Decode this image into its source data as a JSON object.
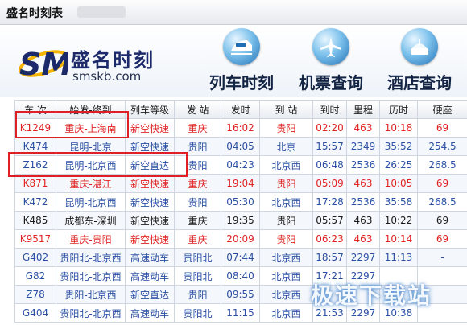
{
  "window": {
    "title": "盛名时刻表"
  },
  "brand": {
    "name": "盛名时刻",
    "domain": "smskb.com",
    "mark": "SM"
  },
  "nav": [
    {
      "label": "列车时刻",
      "icon": "train-icon"
    },
    {
      "label": "机票查询",
      "icon": "airplane-icon"
    },
    {
      "label": "酒店查询",
      "icon": "hotel-icon"
    }
  ],
  "table": {
    "columns": [
      "车 次",
      "始发-终到",
      "列车等级",
      "发 站",
      "发时",
      "到 站",
      "到时",
      "里程",
      "历时",
      "硬座"
    ],
    "rows": [
      {
        "style": "red",
        "cells": [
          "K1249",
          "重庆-上海南",
          "新空快速",
          "重庆",
          "16:02",
          "贵阳",
          "02:20",
          "463",
          "10:18",
          "69"
        ]
      },
      {
        "style": "blue",
        "cells": [
          "K474",
          "昆明-北京",
          "新空快速",
          "贵阳",
          "04:05",
          "北京",
          "15:57",
          "2349",
          "35:52",
          "254.5"
        ]
      },
      {
        "style": "blue",
        "cells": [
          "Z162",
          "昆明-北京西",
          "新空直达",
          "贵阳",
          "04:23",
          "北京西",
          "06:48",
          "2536",
          "26:25",
          "268.5"
        ]
      },
      {
        "style": "red",
        "cells": [
          "K871",
          "重庆-湛江",
          "新空快速",
          "重庆",
          "19:04",
          "贵阳",
          "05:09",
          "463",
          "10:05",
          "69"
        ]
      },
      {
        "style": "blue",
        "cells": [
          "K472",
          "昆明-北京西",
          "新空快速",
          "贵阳",
          "05:30",
          "北京西",
          "17:28",
          "2536",
          "35:58",
          "268.5"
        ]
      },
      {
        "style": "black",
        "cells": [
          "K485",
          "成都东-深圳",
          "新空快速",
          "重庆",
          "19:35",
          "贵阳",
          "05:57",
          "463",
          "10:22",
          "69"
        ]
      },
      {
        "style": "red",
        "cells": [
          "K9517",
          "重庆-贵阳",
          "新空快速",
          "重庆",
          "20:09",
          "贵阳",
          "06:23",
          "463",
          "10:14",
          "69"
        ]
      },
      {
        "style": "blue",
        "cells": [
          "G402",
          "贵阳北-北京西",
          "高速动车",
          "贵阳北",
          "07:44",
          "北京西",
          "18:57",
          "2297",
          "11:13",
          "-"
        ]
      },
      {
        "style": "blue",
        "cells": [
          "G82",
          "贵阳北-北京西",
          "高速动车",
          "贵阳北",
          "08:40",
          "北京西",
          "17:21",
          "2297",
          "",
          ""
        ]
      },
      {
        "style": "blue",
        "cells": [
          "Z78",
          "贵阳-北京西",
          "新空直达",
          "贵阳",
          "09:55",
          "北京西",
          "",
          "",
          "",
          ""
        ]
      },
      {
        "style": "blue",
        "cells": [
          "G404",
          "贵阳北-北京西",
          "高速动车",
          "贵阳北",
          "11:15",
          "北京西",
          "21:53",
          "2297",
          "10:38",
          ""
        ]
      }
    ]
  },
  "watermark": "极速下载站",
  "colors": {
    "highlight": "#e01e26",
    "red_row": "#e02323",
    "blue_row": "#2a4fa3",
    "brand_navy": "#1d2a6a"
  }
}
